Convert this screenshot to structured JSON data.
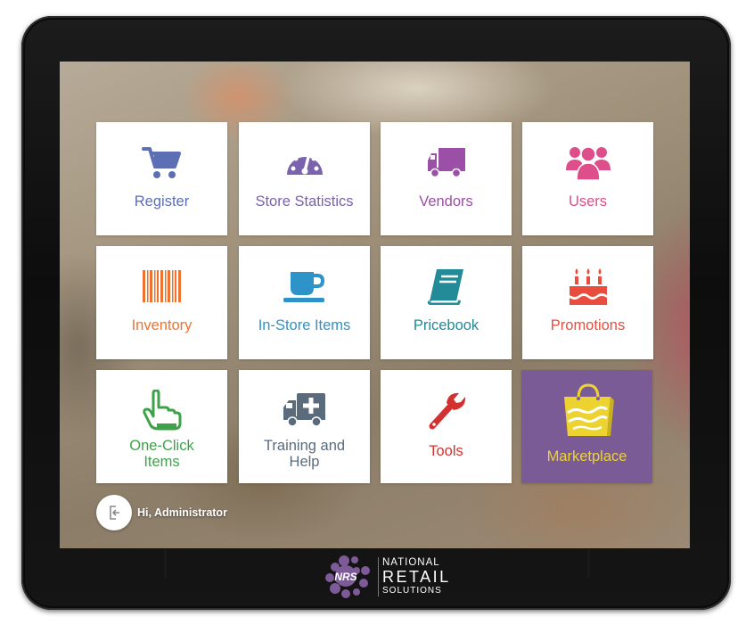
{
  "tiles": [
    {
      "id": "register",
      "label": "Register",
      "color": "#5c6fb5",
      "icon": "cart-icon"
    },
    {
      "id": "store-statistics",
      "label": "Store Statistics",
      "color": "#7a62ae",
      "icon": "gauge-icon"
    },
    {
      "id": "vendors",
      "label": "Vendors",
      "color": "#9c4fa6",
      "icon": "truck-icon"
    },
    {
      "id": "users",
      "label": "Users",
      "color": "#dd4e8a",
      "icon": "users-icon"
    },
    {
      "id": "inventory",
      "label": "Inventory",
      "color": "#ee7331",
      "icon": "barcode-icon"
    },
    {
      "id": "in-store-items",
      "label": "In-Store Items",
      "color": "#2e93c8",
      "icon": "coffee-cup-icon"
    },
    {
      "id": "pricebook",
      "label": "Pricebook",
      "color": "#238a98",
      "icon": "book-icon"
    },
    {
      "id": "promotions",
      "label": "Promotions",
      "color": "#e84d3d",
      "icon": "cake-icon"
    },
    {
      "id": "one-click-items",
      "label": "One-Click Items",
      "color": "#3fa24a",
      "icon": "pointer-hand-icon"
    },
    {
      "id": "training-and-help",
      "label": "Training and Help",
      "color": "#5a6b7c",
      "icon": "ambulance-icon"
    },
    {
      "id": "tools",
      "label": "Tools",
      "color": "#d33030",
      "icon": "wrench-icon"
    },
    {
      "id": "marketplace",
      "label": "Marketplace",
      "color": "#ecd330",
      "icon": "shopping-bag-icon"
    }
  ],
  "user": {
    "greeting": "Hi, Administrator"
  },
  "brand": {
    "line1": "NATIONAL",
    "line2": "RETAIL",
    "line3": "SOLUTIONS",
    "monogram": "NRS"
  },
  "colors": {
    "marketplace_background": "#7b5b96",
    "logo_purple": "#7d5a98",
    "bezel": "#111111"
  }
}
